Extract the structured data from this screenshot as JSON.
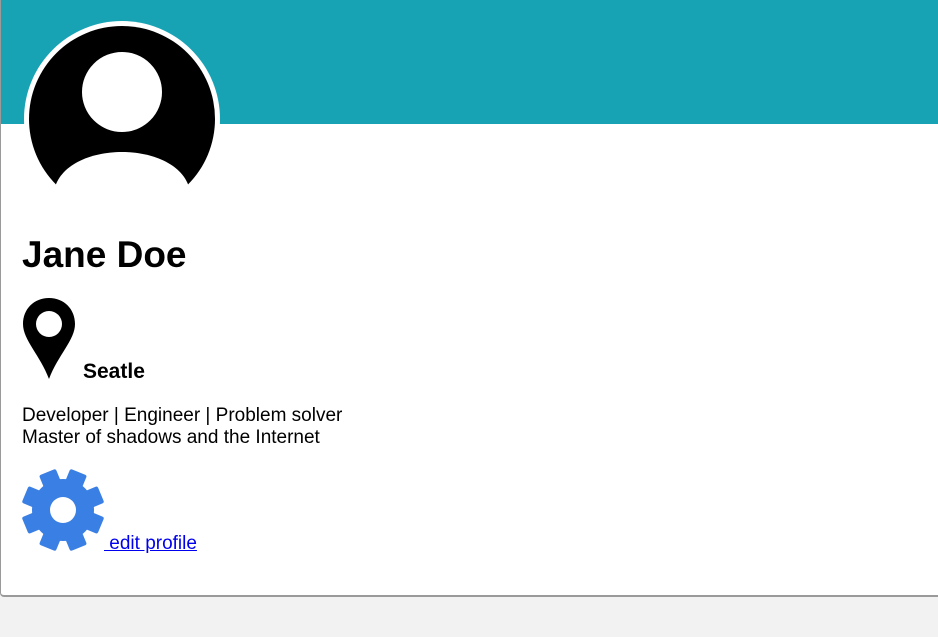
{
  "profile": {
    "name": "Jane Doe",
    "location": "Seatle",
    "bio_line_1": "Developer | Engineer | Problem solver",
    "bio_line_2": "Master of shadows and the Internet",
    "edit_label": " edit profile"
  },
  "icons": {
    "avatar": "user-avatar-icon",
    "location": "map-pin-icon",
    "settings": "gear-icon"
  },
  "colors": {
    "banner": "#18a3b5",
    "gear": "#3a7fe4",
    "link": "#0000ee",
    "page_background": "#f2f2f2",
    "card_background": "#ffffff"
  }
}
